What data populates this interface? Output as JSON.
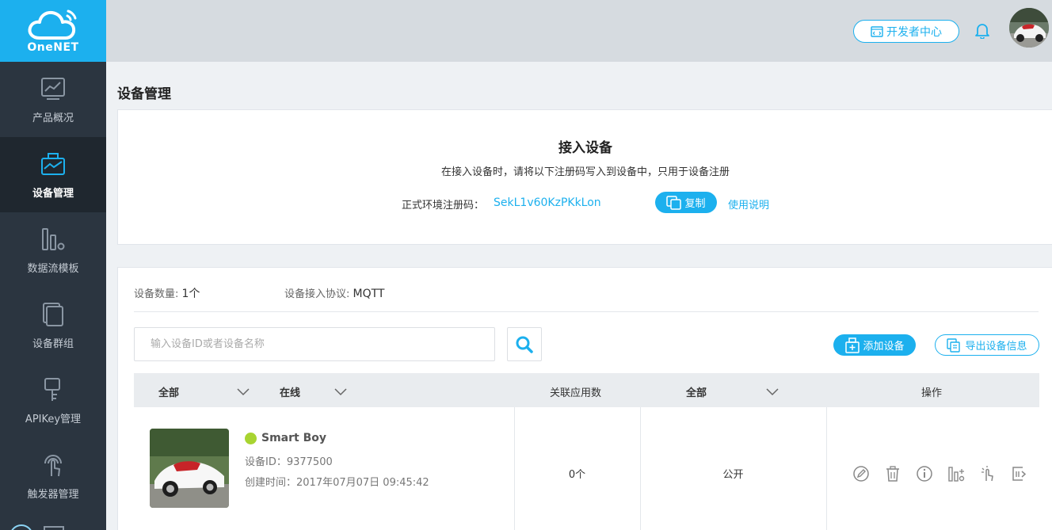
{
  "logo": {
    "text": "OneNET"
  },
  "sidebar": {
    "items": [
      {
        "label": "产品概况",
        "icon": "chart-icon"
      },
      {
        "label": "设备管理",
        "icon": "device-box-icon",
        "active": true
      },
      {
        "label": "数据流模板",
        "icon": "bars-icon"
      },
      {
        "label": "设备群组",
        "icon": "stack-icon"
      },
      {
        "label": "APIKey管理",
        "icon": "key-icon"
      },
      {
        "label": "触发器管理",
        "icon": "touch-icon"
      }
    ]
  },
  "header": {
    "dev_center_label": "开发者中心"
  },
  "page": {
    "title": "设备管理"
  },
  "access": {
    "title": "接入设备",
    "desc": "在接入设备时，请将以下注册码写入到设备中，只用于设备注册",
    "reg_label": "正式环境注册码：",
    "reg_code": "SekL1v60KzPKkLon",
    "copy_label": "复制",
    "usage_label": "使用说明"
  },
  "devices": {
    "count_label": "设备数量:",
    "count_value": "1个",
    "protocol_label": "设备接入协议:",
    "protocol_value": "MQTT",
    "search_placeholder": "输入设备ID或者设备名称",
    "add_label": "添加设备",
    "export_label": "导出设备信息",
    "columns": {
      "all": "全部",
      "online": "在线",
      "apps": "关联应用数",
      "visibility": "全部",
      "ops": "操作"
    },
    "rows": [
      {
        "name": "Smart Boy",
        "id": "设备ID：9377500",
        "created": "创建时间：2017年07月07日 09:45:42",
        "apps": "0个",
        "visibility": "公开",
        "status_color": "#a8d431"
      }
    ]
  },
  "colors": {
    "accent": "#1cb0ee",
    "sidebar": "#2b3540",
    "online": "#a8d431"
  }
}
